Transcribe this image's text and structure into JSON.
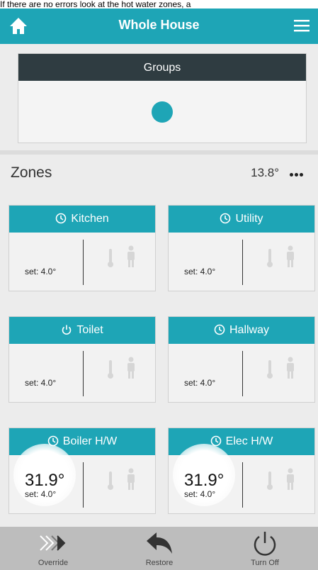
{
  "caption": "If there are no errors look at the hot water zones, a",
  "header": {
    "title": "Whole House",
    "home_icon": "home-icon",
    "menu_icon": "hamburger-menu-icon"
  },
  "groups": {
    "header": "Groups",
    "indicator_color": "#1ea5b6"
  },
  "zones_section": {
    "label": "Zones",
    "temperature": "13.8°",
    "more_icon": "more-dots-icon"
  },
  "zones": [
    {
      "name": "Kitchen",
      "mode_icon": "clock-icon",
      "setpoint": "set: 4.0°",
      "current": ""
    },
    {
      "name": "Utility",
      "mode_icon": "clock-icon",
      "setpoint": "set: 4.0°",
      "current": ""
    },
    {
      "name": "Toilet",
      "mode_icon": "power-icon",
      "setpoint": "set: 4.0°",
      "current": ""
    },
    {
      "name": "Hallway",
      "mode_icon": "clock-icon",
      "setpoint": "set: 4.0°",
      "current": ""
    },
    {
      "name": "Boiler H/W",
      "mode_icon": "clock-icon",
      "setpoint": "set: 4.0°",
      "current": "31.9°"
    },
    {
      "name": "Elec H/W",
      "mode_icon": "clock-icon",
      "setpoint": "set: 4.0°",
      "current": "31.9°"
    }
  ],
  "bottom_bar": {
    "override": "Override",
    "restore": "Restore",
    "turn_off": "Turn Off"
  },
  "colors": {
    "accent": "#1ea5b6",
    "dark_header": "#2f3c41",
    "bottom_bar": "#bdbdbd"
  }
}
